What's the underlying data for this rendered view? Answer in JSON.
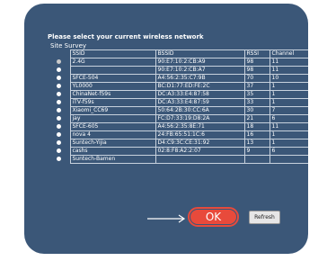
{
  "heading": "Please select your current wireless network",
  "subheading": "Site Survey",
  "columns": [
    "SSID",
    "BSSID",
    "RSSI",
    "Channel"
  ],
  "networks": [
    {
      "ssid": "2.4G",
      "bssid": "90:E7:10:2:CB:A9",
      "rssi": "98",
      "channel": "11",
      "selected": true
    },
    {
      "ssid": "",
      "bssid": "90:E7:10:2:CB:A7",
      "rssi": "98",
      "channel": "11",
      "selected": false
    },
    {
      "ssid": "SFCE-504",
      "bssid": "A4:56:2:35:C7:9B",
      "rssi": "70",
      "channel": "10",
      "selected": false
    },
    {
      "ssid": "YL0000",
      "bssid": "BC:D1:77:ED:FE:2C",
      "rssi": "37",
      "channel": "1",
      "selected": false
    },
    {
      "ssid": "ChinaNet-f59s",
      "bssid": "DC:A3:33:E4:87:58",
      "rssi": "35",
      "channel": "1",
      "selected": false
    },
    {
      "ssid": "iTV-f59s",
      "bssid": "DC:A3:33:E4:87:59",
      "rssi": "33",
      "channel": "1",
      "selected": false
    },
    {
      "ssid": "Xiaomi_CC69",
      "bssid": "50:64:2B:30:CC:6A",
      "rssi": "30",
      "channel": "7",
      "selected": false
    },
    {
      "ssid": "jay",
      "bssid": "FC:D7:33:19:D8:2A",
      "rssi": "21",
      "channel": "6",
      "selected": false
    },
    {
      "ssid": "SFCE-605",
      "bssid": "A4:56:2:35:8E:71",
      "rssi": "18",
      "channel": "11",
      "selected": false
    },
    {
      "ssid": "nova 4",
      "bssid": "24:FB:65:51:1C:6",
      "rssi": "16",
      "channel": "1",
      "selected": false
    },
    {
      "ssid": "Suntech-Yijia",
      "bssid": "D4:C9:3C:CE:31:92",
      "rssi": "13",
      "channel": "1",
      "selected": false
    },
    {
      "ssid": "cashs",
      "bssid": "02:8:F8:A2:2:07",
      "rssi": "9",
      "channel": "6",
      "selected": false
    },
    {
      "ssid": "Suntech-Bamen",
      "bssid": "",
      "rssi": "",
      "channel": "",
      "selected": false
    }
  ],
  "buttons": {
    "ok": "OK",
    "refresh": "Refresh"
  },
  "colors": {
    "panel": "#3b5778",
    "ok": "#e84a3b"
  }
}
